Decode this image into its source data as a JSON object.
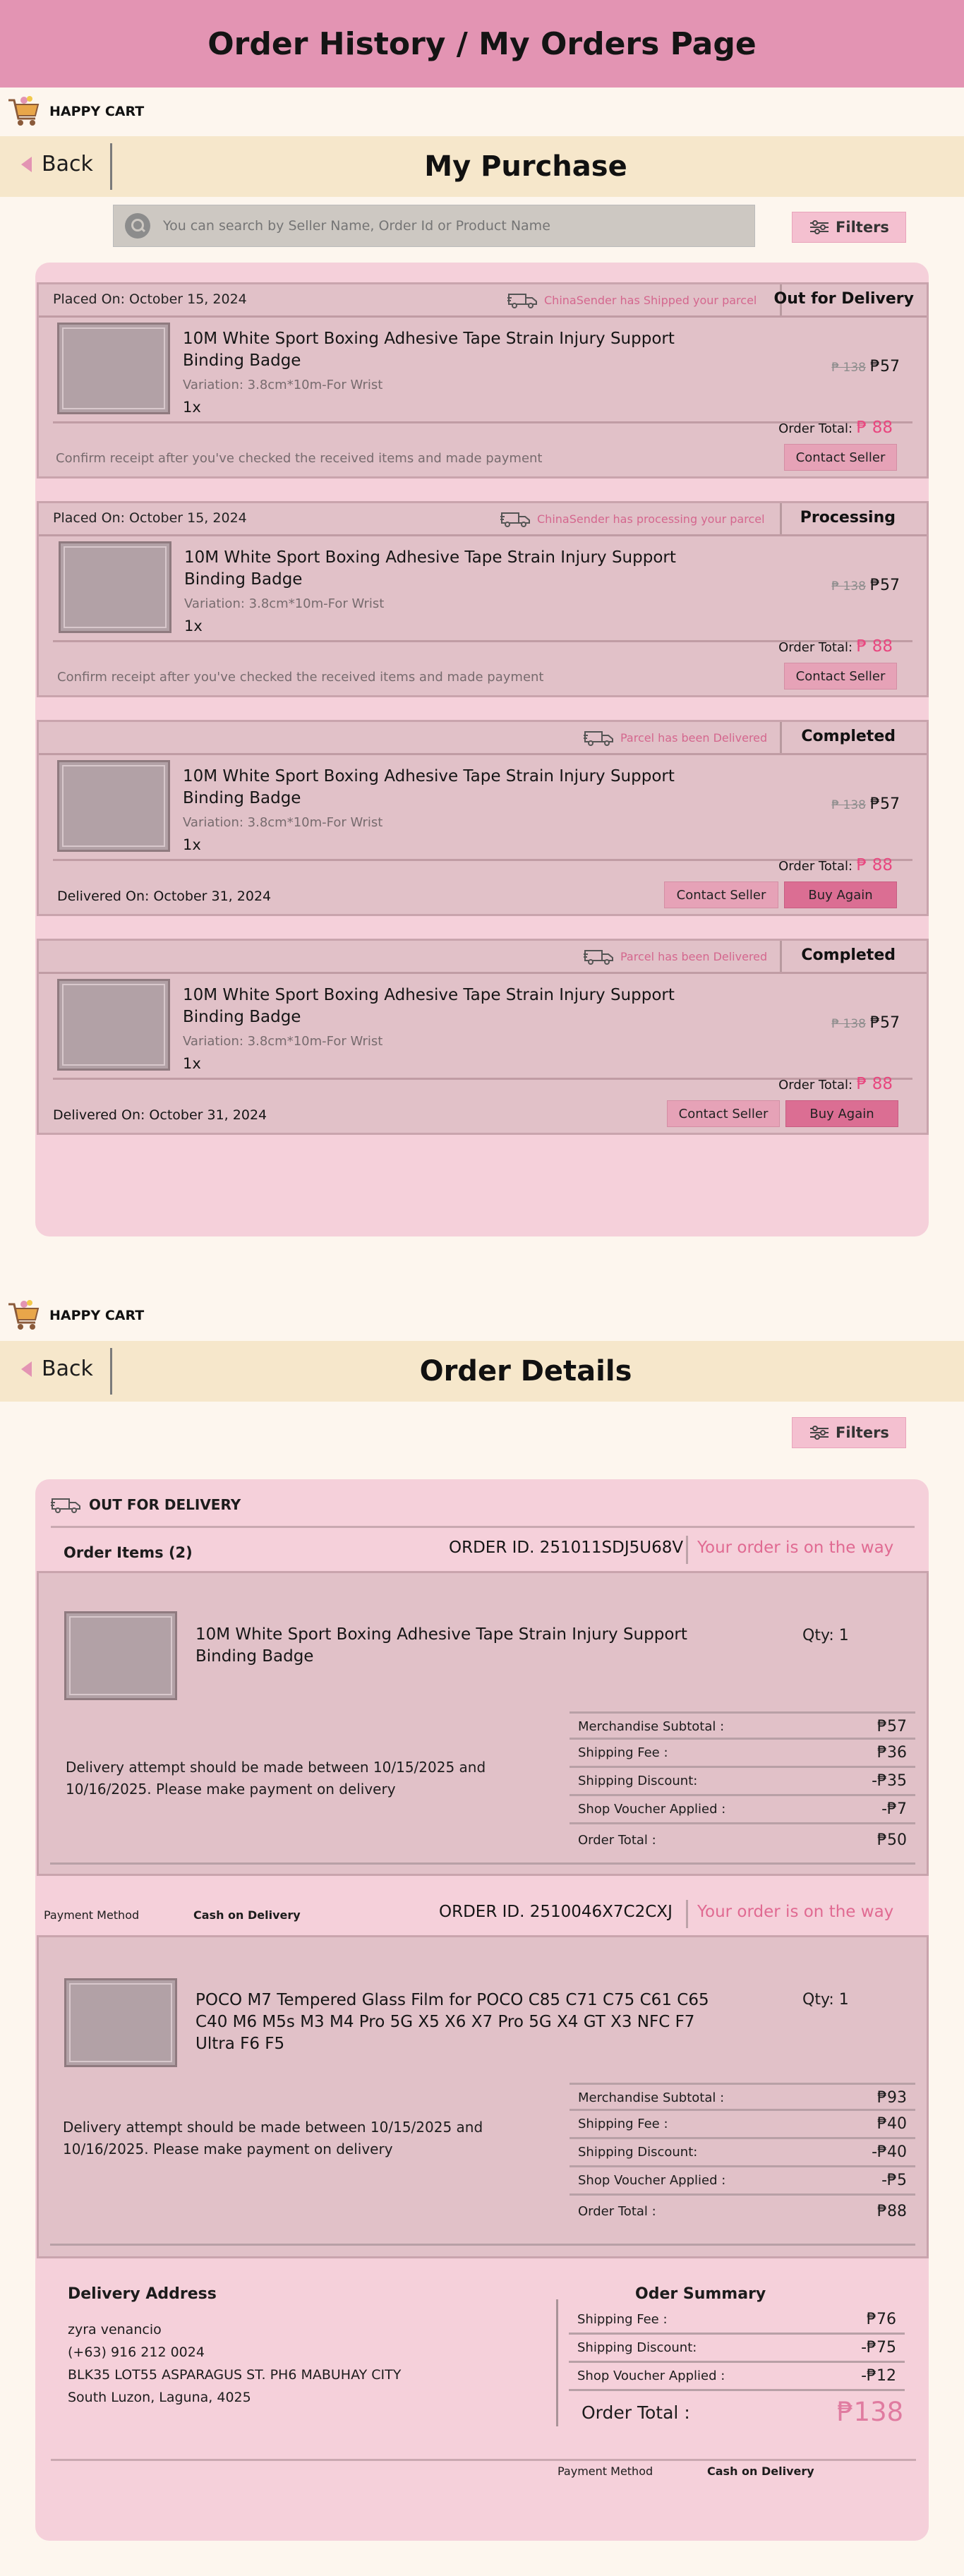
{
  "banner": {
    "title": "Order History / My Orders Page"
  },
  "brand": {
    "name": "HAPPY CART"
  },
  "purchase": {
    "back_label": "Back",
    "title": "My Purchase",
    "search_placeholder": "You can search by Seller Name, Order Id or Product Name",
    "filters_label": "Filters",
    "orders": [
      {
        "date": "Placed On: October 15, 2024",
        "status_msg": "ChinaSender has Shipped your parcel",
        "status": "Out for Delivery",
        "product": "10M White Sport Boxing Adhesive Tape Strain Injury Support Binding Badge",
        "variation": "Variation: 3.8cm*10m-For Wrist",
        "qty": "1x",
        "old_price": "₱ 138",
        "price": "₱57",
        "total_label": "Order Total:",
        "total": "₱ 88",
        "note": "Confirm receipt after you've checked the received items and made payment",
        "contact": "Contact Seller"
      },
      {
        "date": "Placed On: October 15, 2024",
        "status_msg": "ChinaSender has processing your parcel",
        "status": "Processing",
        "product": "10M White Sport Boxing Adhesive Tape Strain Injury Support Binding Badge",
        "variation": "Variation: 3.8cm*10m-For Wrist",
        "qty": "1x",
        "old_price": "₱ 138",
        "price": "₱57",
        "total_label": "Order Total:",
        "total": "₱ 88",
        "note": "Confirm receipt after you've checked the received items and made payment",
        "contact": "Contact Seller"
      },
      {
        "status_msg": "Parcel has been Delivered",
        "status": "Completed",
        "product": "10M White Sport Boxing Adhesive Tape Strain Injury Support Binding Badge",
        "variation": "Variation: 3.8cm*10m-For Wrist",
        "qty": "1x",
        "old_price": "₱ 138",
        "price": "₱57",
        "total_label": "Order Total:",
        "total": "₱ 88",
        "delivered": "Delivered On: October 31, 2024",
        "contact": "Contact Seller",
        "buy_again": "Buy Again"
      },
      {
        "status_msg": "Parcel has been Delivered",
        "status": "Completed",
        "product": "10M White Sport Boxing Adhesive Tape Strain Injury Support Binding Badge",
        "variation": "Variation: 3.8cm*10m-For Wrist",
        "qty": "1x",
        "old_price": "₱ 138",
        "price": "₱57",
        "total_label": "Order Total:",
        "total": "₱ 88",
        "delivered": "Delivered On: October 31, 2024",
        "contact": "Contact Seller",
        "buy_again": "Buy Again"
      }
    ]
  },
  "details": {
    "back_label": "Back",
    "title": "Order Details",
    "filters_label": "Filters",
    "status": "OUT FOR DELIVERY",
    "items_label": "Order Items (2)",
    "orders": [
      {
        "order_id": "ORDER ID. 251011SDJ5U68V",
        "status_text": "Your order is on the way",
        "product": "10M White Sport Boxing Adhesive Tape Strain Injury Support Binding Badge",
        "qty": "Qty: 1",
        "note": "Delivery attempt should be made between 10/15/2025 and 10/16/2025. Please make payment on delivery",
        "summary": [
          {
            "label": "Merchandise Subtotal :",
            "value": "₱57"
          },
          {
            "label": "Shipping Fee :",
            "value": "₱36"
          },
          {
            "label": "Shipping Discount:",
            "value": "-₱35"
          },
          {
            "label": "Shop Voucher Applied :",
            "value": "-₱7"
          },
          {
            "label": "Order Total :",
            "value": "₱50"
          }
        ]
      },
      {
        "order_id": "ORDER ID. 2510046X7C2CXJ",
        "status_text": "Your order is on the way",
        "product": "POCO M7 Tempered Glass Film for POCO C85 C71 C75 C61 C65 C40 M6 M5s M3 M4 Pro 5G X5 X6 X7 Pro 5G X4 GT X3 NFC F7 Ultra F6 F5",
        "qty": "Qty: 1",
        "note": "Delivery attempt should be made between 10/15/2025 and 10/16/2025. Please make payment on delivery",
        "summary": [
          {
            "label": "Merchandise Subtotal :",
            "value": "₱93"
          },
          {
            "label": "Shipping Fee :",
            "value": "₱40"
          },
          {
            "label": "Shipping Discount:",
            "value": "-₱40"
          },
          {
            "label": "Shop Voucher Applied :",
            "value": "-₱5"
          },
          {
            "label": "Order Total :",
            "value": "₱88"
          }
        ]
      }
    ],
    "payment_label": "Payment Method",
    "payment_value": "Cash on Delivery",
    "address": {
      "title": "Delivery Address",
      "name": "zyra venancio",
      "phone": "(+63) 916 212 0024",
      "street": "BLK35 LOT55 ASPARAGUS ST. PH6 MABUHAY CITY",
      "region": "South Luzon, Laguna, 4025"
    },
    "summary": {
      "title": "Oder Summary",
      "rows": [
        {
          "label": "Shipping Fee :",
          "value": "₱76"
        },
        {
          "label": "Shipping Discount:",
          "value": "-₱75"
        },
        {
          "label": "Shop Voucher Applied :",
          "value": "-₱12"
        }
      ],
      "total_label": "Order Total :",
      "total": "₱138"
    }
  },
  "colors": {
    "accent": "#e394b3",
    "highlight": "#e8477f",
    "panel": "#f5d0da",
    "header": "#f6e7cb"
  },
  "icons": [
    "cart-icon",
    "back-arrow-icon",
    "search-icon",
    "filters-icon",
    "truck-icon"
  ]
}
